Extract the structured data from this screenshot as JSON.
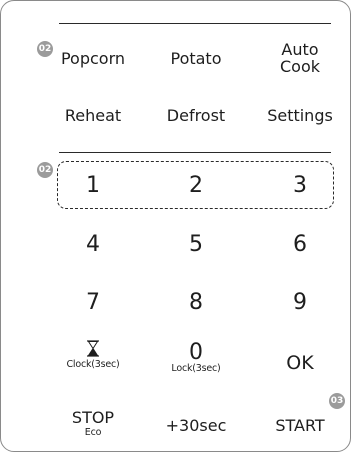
{
  "panel": {
    "badges": {
      "program": "02",
      "number": "02",
      "start": "03"
    },
    "programs": [
      {
        "label": "Popcorn"
      },
      {
        "label": "Potato"
      },
      {
        "label": "Auto\nCook"
      },
      {
        "label": "Reheat"
      },
      {
        "label": "Defrost"
      },
      {
        "label": "Settings"
      }
    ],
    "keypad": [
      "1",
      "2",
      "3",
      "4",
      "5",
      "6",
      "7",
      "8",
      "9"
    ],
    "clock": {
      "icon": "hourglass-icon",
      "sublabel": "Clock(3sec)"
    },
    "zero": {
      "label": "0",
      "sublabel": "Lock(3sec)"
    },
    "ok": {
      "label": "OK"
    },
    "stop": {
      "label": "STOP",
      "sublabel": "Eco"
    },
    "plus30": {
      "label": "+30sec"
    },
    "start": {
      "label": "START"
    }
  }
}
